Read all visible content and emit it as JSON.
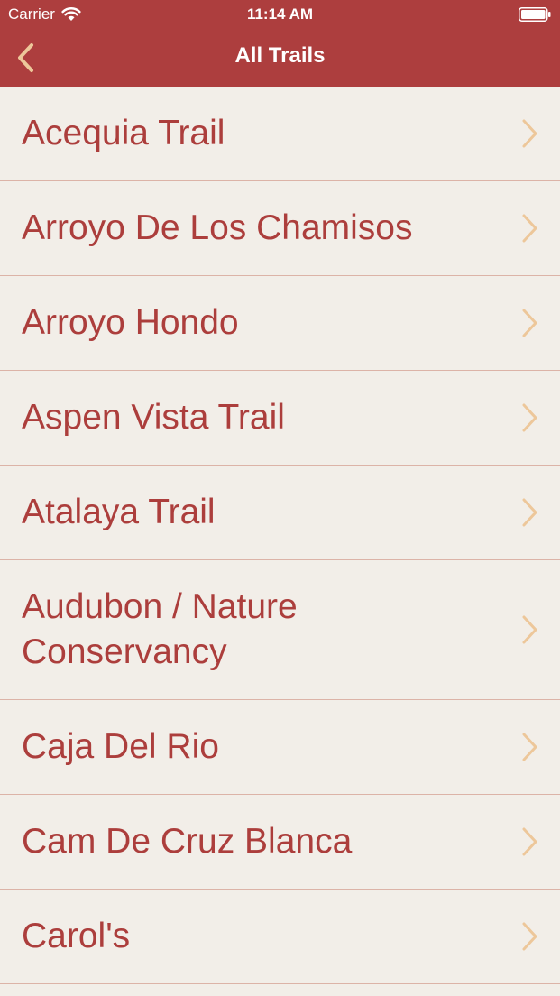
{
  "status_bar": {
    "carrier": "Carrier",
    "time": "11:14 AM"
  },
  "nav": {
    "title": "All Trails",
    "back_icon": "chevron-left-icon"
  },
  "colors": {
    "header_bg": "#AD3E3E",
    "list_bg": "#F2EEE8",
    "row_text": "#AC3E3C",
    "chevron": "#EDC79A",
    "separator": "#DCB3A7"
  },
  "trails": [
    {
      "label": "Acequia Trail"
    },
    {
      "label": "Arroyo De Los Chamisos"
    },
    {
      "label": "Arroyo Hondo"
    },
    {
      "label": "Aspen Vista Trail"
    },
    {
      "label": "Atalaya Trail"
    },
    {
      "label": "Audubon / Nature Conservancy"
    },
    {
      "label": "Caja Del Rio"
    },
    {
      "label": "Cam De Cruz Blanca"
    },
    {
      "label": "Carol's"
    }
  ]
}
